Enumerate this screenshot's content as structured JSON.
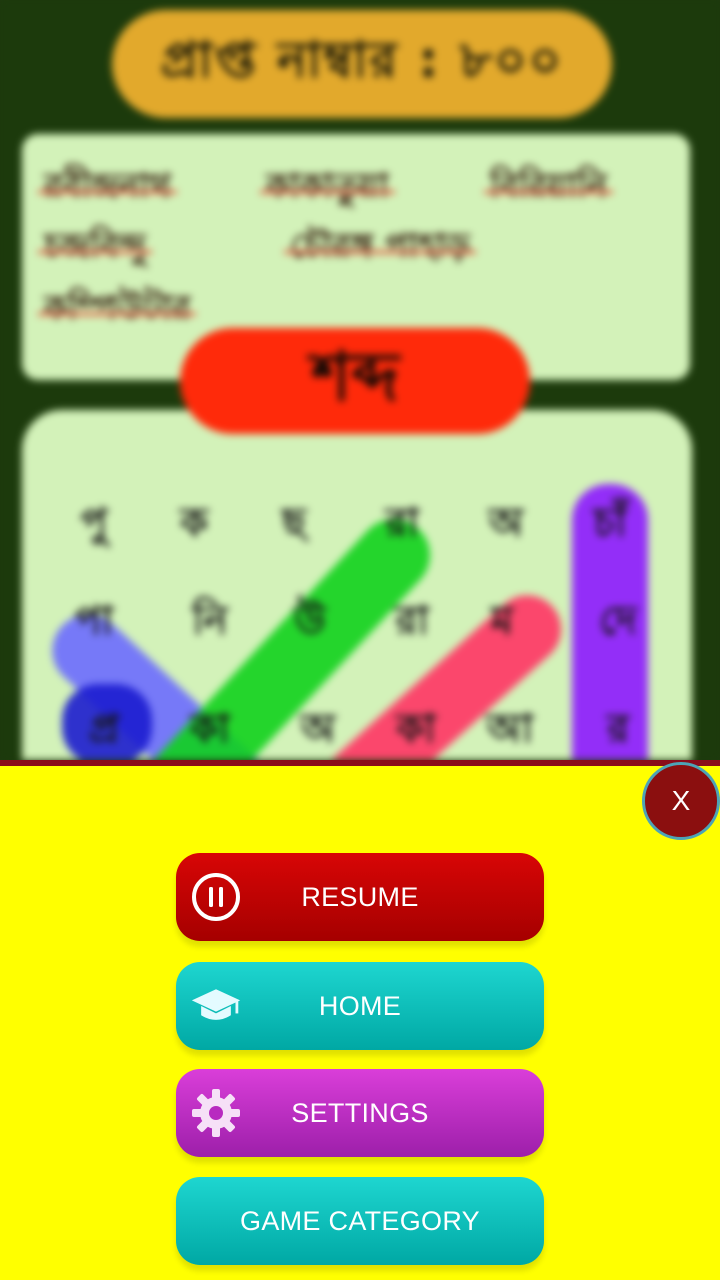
{
  "game": {
    "score_label": "প্রাপ্ত নাম্বার : ৮০০",
    "title": "শব্দ",
    "found_words": [
      "রবীন্দ্রনাথ",
      "কাকাতুয়া",
      "বিরিয়ানি",
      "চন্দ্রবিন্দু",
      "চৌরঙ্গ পাহাড়",
      "কম্পিউটার"
    ],
    "grid_rows": [
      [
        "পু",
        "ক",
        "ছ",
        "রা",
        "অ",
        "চাঁ"
      ],
      [
        "পা",
        "নি",
        "উ",
        "রা",
        "ম",
        "দে"
      ],
      [
        "প্র",
        "কা",
        "অ",
        "কা",
        "আ",
        "র"
      ]
    ],
    "stroke_colors": [
      "#6b6bff",
      "#11d11d",
      "#ff3464",
      "#8c18ff",
      "#1c1ccf"
    ]
  },
  "pause_menu": {
    "close_label": "X",
    "resume_label": "RESUME",
    "home_label": "HOME",
    "settings_label": "SETTINGS",
    "category_label": "GAME CATEGORY",
    "icons": {
      "resume": "pause-circle-icon",
      "home": "graduation-cap-icon",
      "settings": "gear-icon"
    },
    "colors": {
      "panel_bg": "#ffff00",
      "close": "#8b0f0f",
      "resume": "#c80303",
      "home": "#10bfbb",
      "settings": "#c032c7",
      "category": "#10bfbb"
    }
  }
}
